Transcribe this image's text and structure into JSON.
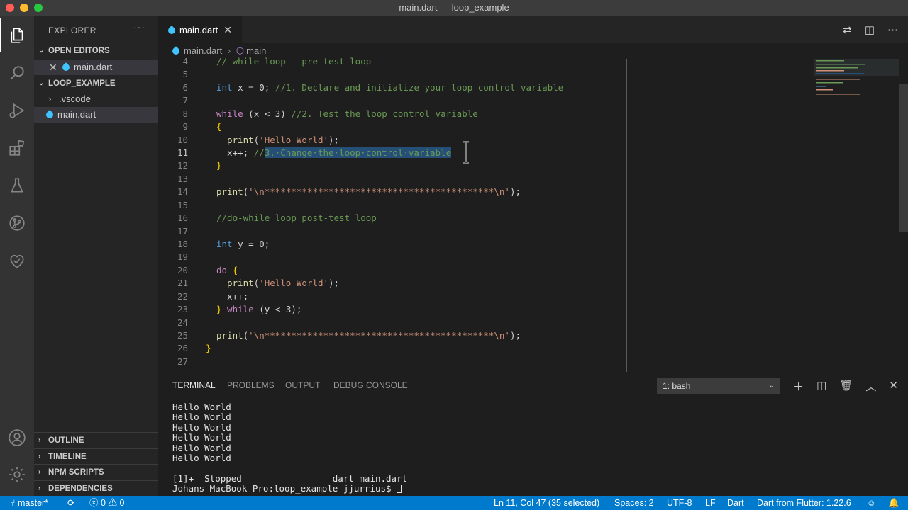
{
  "window": {
    "title": "main.dart — loop_example"
  },
  "sidebar": {
    "header": "EXPLORER",
    "more": "···",
    "open_editors_label": "OPEN EDITORS",
    "open_editor_file": "main.dart",
    "folder_label": "LOOP_EXAMPLE",
    "folder_items": [
      ".vscode",
      "main.dart"
    ],
    "outline_label": "OUTLINE",
    "timeline_label": "TIMELINE",
    "npm_label": "NPM SCRIPTS",
    "deps_label": "DEPENDENCIES"
  },
  "editor": {
    "tab_label": "main.dart",
    "breadcrumb_file": "main.dart",
    "breadcrumb_symbol": "main"
  },
  "code": {
    "line_numbers": [
      "4",
      "5",
      "6",
      "7",
      "8",
      "9",
      "10",
      "11",
      "12",
      "13",
      "14",
      "15",
      "16",
      "17",
      "18",
      "19",
      "20",
      "21",
      "22",
      "23",
      "24",
      "25",
      "26",
      "27"
    ],
    "l4": "// while loop - pre-test loop",
    "l6_kw": "int",
    "l6_a": " x = 0; ",
    "l6_cm": "//1. Declare and initialize your loop control variable",
    "l8_kw": "while",
    "l8_a": " (x < 3) ",
    "l8_cm": "//2. Test the loop control variable",
    "l9": "{",
    "l10_fn": "print",
    "l10_a": "(",
    "l10_str": "'Hello World'",
    "l10_b": ");",
    "l11_a": "x++; ",
    "l11_cm": "//",
    "l11_sel": "3.·Change·the·loop·control·variable",
    "l12": "}",
    "l14_fn": "print",
    "l14_a": "(",
    "l14_str": "'\\n*******************************************\\n'",
    "l14_b": ");",
    "l16": "//do-while loop post-test loop",
    "l18_kw": "int",
    "l18_a": " y = 0;",
    "l20_kw": "do",
    "l20_br": " {",
    "l21_fn": "print",
    "l21_a": "(",
    "l21_str": "'Hello World'",
    "l21_b": ");",
    "l22": "x++;",
    "l23_br": "}",
    "l23_kw": " while",
    "l23_a": " (y < 3);",
    "l25_fn": "print",
    "l25_a": "(",
    "l25_str": "'\\n*******************************************\\n'",
    "l25_b": ");",
    "l26": "}"
  },
  "panel": {
    "tabs": [
      "TERMINAL",
      "PROBLEMS",
      "OUTPUT",
      "DEBUG CONSOLE"
    ],
    "terminal_select": "1: bash",
    "output_lines": [
      "Hello World",
      "Hello World",
      "Hello World",
      "Hello World",
      "Hello World",
      "Hello World"
    ],
    "job_line": "[1]+  Stopped                 dart main.dart",
    "prompt": "Johans-MacBook-Pro:loop_example jjurrius$ "
  },
  "statusbar": {
    "branch": "master*",
    "errors": "0",
    "warnings": "0",
    "cursor": "Ln 11, Col 47 (35 selected)",
    "spaces": "Spaces: 2",
    "encoding": "UTF-8",
    "eol": "LF",
    "language": "Dart",
    "sdk": "Dart from Flutter: 1.22.6"
  }
}
